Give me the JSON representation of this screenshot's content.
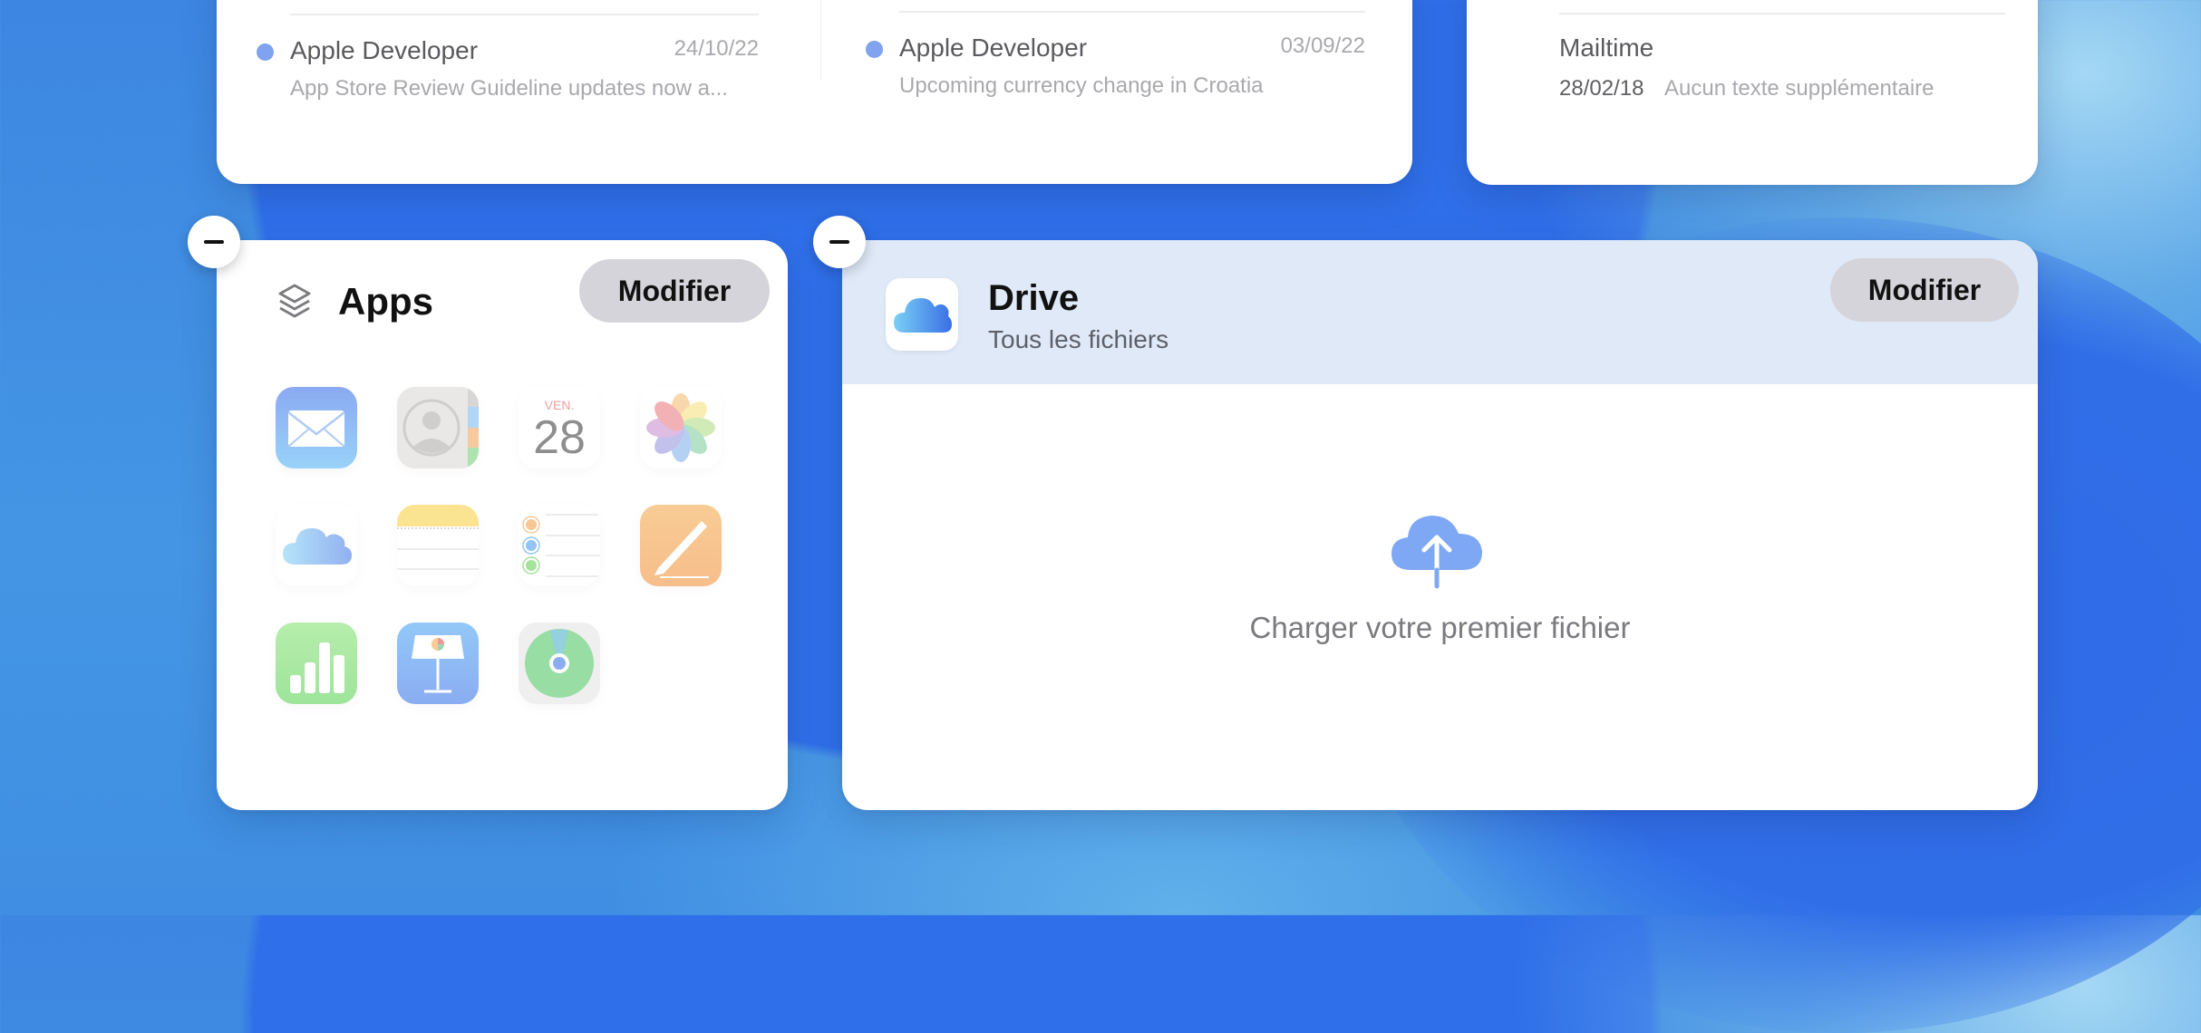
{
  "mail_widget": {
    "messages": [
      {
        "sender": "Apple Developer",
        "date": "24/10/22",
        "subject": "App Store Review Guideline updates now a...",
        "unread": true
      },
      {
        "sender": "Apple Developer",
        "date": "03/09/22",
        "subject": "Upcoming currency change in Croatia",
        "unread": true
      }
    ]
  },
  "notes_widget": {
    "item": {
      "title": "Mailtime",
      "date": "28/02/18",
      "preview": "Aucun texte supplémentaire"
    }
  },
  "apps_widget": {
    "title": "Apps",
    "title_icon": "layers-icon",
    "edit_label": "Modifier",
    "remove_icon": "minus-icon",
    "apps": [
      {
        "name": "Mail",
        "icon": "mail-icon"
      },
      {
        "name": "Contacts",
        "icon": "contacts-icon"
      },
      {
        "name": "Calendar",
        "icon": "calendar-icon",
        "day_label": "VEN.",
        "day_number": "28"
      },
      {
        "name": "Photos",
        "icon": "photos-icon"
      },
      {
        "name": "iCloud Drive",
        "icon": "icloud-drive-icon"
      },
      {
        "name": "Notes",
        "icon": "notes-icon"
      },
      {
        "name": "Reminders",
        "icon": "reminders-icon"
      },
      {
        "name": "Pages",
        "icon": "pages-icon"
      },
      {
        "name": "Numbers",
        "icon": "numbers-icon"
      },
      {
        "name": "Keynote",
        "icon": "keynote-icon"
      },
      {
        "name": "Find My",
        "icon": "find-my-icon"
      }
    ]
  },
  "drive_widget": {
    "title": "Drive",
    "subtitle": "Tous les fichiers",
    "edit_label": "Modifier",
    "remove_icon": "minus-icon",
    "empty_icon": "cloud-upload-icon",
    "empty_label": "Charger votre premier fichier"
  },
  "colors": {
    "accent_dot": "#7fa3ee",
    "drive_header_bg": "#dfe9f7",
    "button_bg": "#d5d4da",
    "upload_icon": "#7ea8f4"
  }
}
